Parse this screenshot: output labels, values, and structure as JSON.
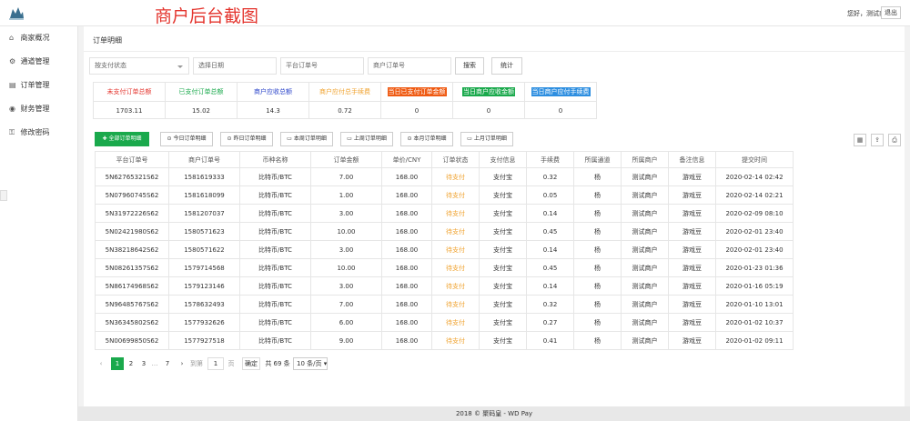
{
  "header": {
    "banner": "商户后台截图",
    "greeting": "您好，测试商户",
    "logout_label": "退出"
  },
  "sidebar": {
    "items": [
      {
        "label": "商家概况",
        "icon": "home-icon",
        "glyph": "⌂"
      },
      {
        "label": "通道管理",
        "icon": "settings-icon",
        "glyph": "⚙"
      },
      {
        "label": "订单管理",
        "icon": "list-icon",
        "glyph": "▤"
      },
      {
        "label": "财务管理",
        "icon": "finance-icon",
        "glyph": "◉"
      },
      {
        "label": "修改密码",
        "icon": "lock-icon",
        "glyph": "⚿"
      }
    ]
  },
  "page": {
    "title": "订单明细"
  },
  "filters": {
    "pay_status_placeholder": "按支付状态",
    "date_placeholder": "选择日期",
    "platform_order_placeholder": "平台订单号",
    "merchant_order_placeholder": "商户订单号",
    "search_label": "搜索",
    "stats_label": "统计"
  },
  "stats": [
    {
      "label": "未支付订单总额",
      "value": "1703.11",
      "color": "#e4342d",
      "bg": ""
    },
    {
      "label": "已支付订单总额",
      "value": "15.02",
      "color": "#1aa94c",
      "bg": ""
    },
    {
      "label": "商户应收总额",
      "value": "14.3",
      "color": "#2a43c9",
      "bg": ""
    },
    {
      "label": "商户应付总手续费",
      "value": "0.72",
      "color": "#f0a330",
      "bg": ""
    },
    {
      "label": "当日已支付订单金额",
      "value": "0",
      "color": "#ffffff",
      "bg": "#ef5a12"
    },
    {
      "label": "当日商户应收金额",
      "value": "0",
      "color": "#ffffff",
      "bg": "#1aa94c"
    },
    {
      "label": "当日商户应付手续费",
      "value": "0",
      "color": "#ffffff",
      "bg": "#2d8ee0"
    }
  ],
  "tabs": [
    {
      "label": "全部订单明细",
      "glyph": "✚"
    },
    {
      "label": "今日订单明细",
      "glyph": "⊙"
    },
    {
      "label": "昨日订单明细",
      "glyph": "⊙"
    },
    {
      "label": "本周订单明细",
      "glyph": "▭"
    },
    {
      "label": "上周订单明细",
      "glyph": "▭"
    },
    {
      "label": "本月订单明细",
      "glyph": "⊙"
    },
    {
      "label": "上月订单明细",
      "glyph": "▭"
    }
  ],
  "toolbar_icons": [
    {
      "name": "columns-icon",
      "glyph": "▦"
    },
    {
      "name": "export-icon",
      "glyph": "⇪"
    },
    {
      "name": "print-icon",
      "glyph": "⎙"
    }
  ],
  "table": {
    "columns": [
      "平台订单号",
      "商户订单号",
      "币种名称",
      "订单金额",
      "单价/CNY",
      "订单状态",
      "支付信息",
      "手续费",
      "所属通道",
      "所属商户",
      "备注信息",
      "提交时间"
    ],
    "rows": [
      [
        "5N62765321S62",
        "1581619333",
        "比特币/BTC",
        "7.00",
        "168.00",
        "待支付",
        "支付宝",
        "0.32",
        "杨",
        "测试商户",
        "游戏豆",
        "2020-02-14 02:42"
      ],
      [
        "5N07960745S62",
        "1581618099",
        "比特币/BTC",
        "1.00",
        "168.00",
        "待支付",
        "支付宝",
        "0.05",
        "杨",
        "测试商户",
        "游戏豆",
        "2020-02-14 02:21"
      ],
      [
        "5N31972226S62",
        "1581207037",
        "比特币/BTC",
        "3.00",
        "168.00",
        "待支付",
        "支付宝",
        "0.14",
        "杨",
        "测试商户",
        "游戏豆",
        "2020-02-09 08:10"
      ],
      [
        "5N02421980S62",
        "1580571623",
        "比特币/BTC",
        "10.00",
        "168.00",
        "待支付",
        "支付宝",
        "0.45",
        "杨",
        "测试商户",
        "游戏豆",
        "2020-02-01 23:40"
      ],
      [
        "5N38218642S62",
        "1580571622",
        "比特币/BTC",
        "3.00",
        "168.00",
        "待支付",
        "支付宝",
        "0.14",
        "杨",
        "测试商户",
        "游戏豆",
        "2020-02-01 23:40"
      ],
      [
        "5N08261357S62",
        "1579714568",
        "比特币/BTC",
        "10.00",
        "168.00",
        "待支付",
        "支付宝",
        "0.45",
        "杨",
        "测试商户",
        "游戏豆",
        "2020-01-23 01:36"
      ],
      [
        "5N86174968S62",
        "1579123146",
        "比特币/BTC",
        "3.00",
        "168.00",
        "待支付",
        "支付宝",
        "0.14",
        "杨",
        "测试商户",
        "游戏豆",
        "2020-01-16 05:19"
      ],
      [
        "5N96485767S62",
        "1578632493",
        "比特币/BTC",
        "7.00",
        "168.00",
        "待支付",
        "支付宝",
        "0.32",
        "杨",
        "测试商户",
        "游戏豆",
        "2020-01-10 13:01"
      ],
      [
        "5N36345802S62",
        "1577932626",
        "比特币/BTC",
        "6.00",
        "168.00",
        "待支付",
        "支付宝",
        "0.27",
        "杨",
        "测试商户",
        "游戏豆",
        "2020-01-02 10:37"
      ],
      [
        "5N00699850S62",
        "1577927518",
        "比特币/BTC",
        "9.00",
        "168.00",
        "待支付",
        "支付宝",
        "0.41",
        "杨",
        "测试商户",
        "游戏豆",
        "2020-01-02 09:11"
      ]
    ]
  },
  "pagination": {
    "prev": "‹",
    "pages": [
      "1",
      "2",
      "3",
      "…",
      "7"
    ],
    "next": "›",
    "goto_label": "到第",
    "goto_value": "1",
    "page_unit": "页",
    "confirm_label": "确定",
    "total_label": "共 69 条",
    "page_size": "10 条/页"
  },
  "footer": {
    "text": "2018 © 聚码皇 - WD Pay"
  }
}
